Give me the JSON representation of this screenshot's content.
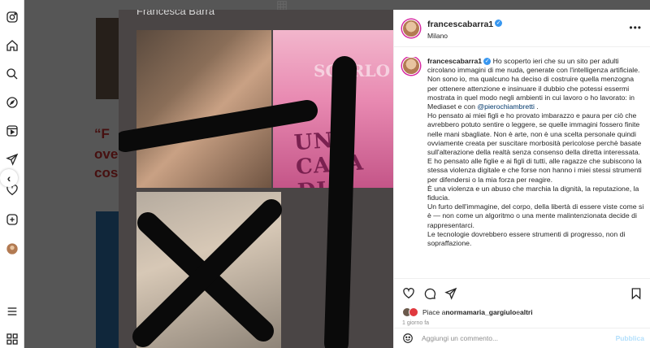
{
  "collage": {
    "title": "Francesca Barra",
    "cake_text": "UNA CASA DI",
    "cake_text_top": "SCARLO"
  },
  "post": {
    "username": "francescabarra1",
    "location": "Milano",
    "verified_mark": "✓",
    "caption_paragraphs": [
      "Ho scoperto ieri che su un sito per adulti circolano immagini di me nuda, generate con l'intelligenza artificiale.",
      "Non sono io, ma qualcuno ha deciso di costruire quella menzogna per ottenere attenzione e insinuare il dubbio che potessi essermi mostrata in quel modo negli ambienti in cui lavoro o ho lavorato: in Mediaset e con",
      "Ho pensato ai miei figli e ho provato imbarazzo e paura per ciò che avrebbero potuto sentire o leggere, se quelle immagini fossero finite nelle mani sbagliate. Non è arte, non è una scelta personale quindi ovviamente creata per suscitare morbosità pericolose perchè basate sull'alterazione della realtà senza consenso della diretta interessata.",
      "E ho pensato alle figlie e ai figli di tutti, alle ragazze che subiscono la stessa violenza digitale e che forse non hanno i miei stessi strumenti per difendersi o la mia forza per reagire.",
      "È una violenza e un abuso che marchia la dignità, la reputazione, la fiducia.",
      "Un furto dell'immagine, del corpo, della libertà di essere viste come si è — non come un algoritmo o una mente malintenzionata decide di rappresentarci.",
      "Le tecnologie dovrebbero essere strumenti di progresso, non di sopraffazione."
    ],
    "mention": "@pierochiambretti",
    "mention_suffix": " .",
    "likes_prefix": "Piace a ",
    "liked_by": "normamaria_gargiulo",
    "likes_middle": " e ",
    "likes_others": "altri",
    "time_ago": "1 giorno fa",
    "comment_placeholder": "Aggiungi un commento...",
    "post_button": "Pubblica"
  },
  "sidebar_icons": [
    "instagram-icon",
    "home-icon",
    "search-icon",
    "explore-icon",
    "reels-icon",
    "messages-icon",
    "notifications-icon",
    "create-icon",
    "profile-icon",
    "menu-icon",
    "more-apps-icon"
  ],
  "colors": {
    "accent_blue": "#3897f0",
    "mention_blue": "#00376b",
    "post_button_disabled": "#b2dffc",
    "bg_headline_red": "#c8302e"
  },
  "background_feed": {
    "line1": "“F",
    "line2": "ove",
    "line3": "cos"
  }
}
